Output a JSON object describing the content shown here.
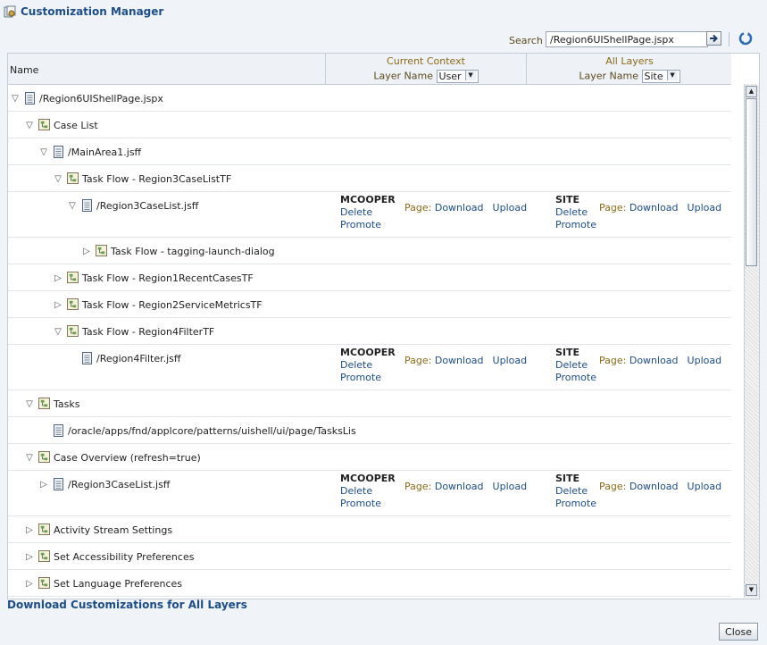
{
  "window": {
    "title": "Customization Manager"
  },
  "search": {
    "label": "Search",
    "value": "/Region6UIShellPage.jspx"
  },
  "header": {
    "name": "Name",
    "current_context": {
      "caption": "Current Context",
      "layer_label": "Layer Name",
      "layer_value": "User"
    },
    "all_layers": {
      "caption": "All Layers",
      "layer_label": "Layer Name",
      "layer_value": "Site"
    }
  },
  "common": {
    "delete": "Delete",
    "promote": "Promote",
    "page": "Page:",
    "download": "Download",
    "upload": "Upload"
  },
  "rows": [
    {
      "label": "/Region6UIShellPage.jspx",
      "depth": 0,
      "disc": "▽",
      "icon": "page-icon"
    },
    {
      "label": "Case List",
      "depth": 1,
      "disc": "▽",
      "icon": "taskflow-icon"
    },
    {
      "label": "/MainArea1.jsff",
      "depth": 2,
      "disc": "▽",
      "icon": "page-icon"
    },
    {
      "label": "Task Flow - Region3CaseListTF",
      "depth": 3,
      "disc": "▽",
      "icon": "taskflow-icon"
    },
    {
      "label": "/Region3CaseList.jsff",
      "depth": 4,
      "disc": "▽",
      "icon": "page-icon",
      "cust": {
        "user": "MCOOPER",
        "site": "SITE"
      }
    },
    {
      "label": "Task Flow - tagging-launch-dialog",
      "depth": 5,
      "disc": "▷",
      "icon": "taskflow-icon"
    },
    {
      "label": "Task Flow - Region1RecentCasesTF",
      "depth": 3,
      "disc": "▷",
      "icon": "taskflow-icon"
    },
    {
      "label": "Task Flow - Region2ServiceMetricsTF",
      "depth": 3,
      "disc": "▷",
      "icon": "taskflow-icon"
    },
    {
      "label": "Task Flow - Region4FilterTF",
      "depth": 3,
      "disc": "▽",
      "icon": "taskflow-icon"
    },
    {
      "label": "/Region4Filter.jsff",
      "depth": 4,
      "disc": "",
      "icon": "page-icon",
      "cust": {
        "user": "MCOOPER",
        "site": "SITE"
      }
    },
    {
      "label": "Tasks",
      "depth": 1,
      "disc": "▽",
      "icon": "taskflow-icon"
    },
    {
      "label": "/oracle/apps/fnd/applcore/patterns/uishell/ui/page/TasksLis",
      "depth": 2,
      "disc": "",
      "icon": "page-icon"
    },
    {
      "label": "Case Overview (refresh=true)",
      "depth": 1,
      "disc": "▽",
      "icon": "taskflow-icon"
    },
    {
      "label": "/Region3CaseList.jsff",
      "depth": 2,
      "disc": "▷",
      "icon": "page-icon",
      "cust": {
        "user": "MCOOPER",
        "site": "SITE"
      }
    },
    {
      "label": "Activity Stream Settings",
      "depth": 1,
      "disc": "▷",
      "icon": "taskflow-icon"
    },
    {
      "label": "Set Accessibility Preferences",
      "depth": 1,
      "disc": "▷",
      "icon": "taskflow-icon"
    },
    {
      "label": "Set Language Preferences",
      "depth": 1,
      "disc": "▷",
      "icon": "taskflow-icon"
    }
  ],
  "footer": {
    "download_all": "Download Customizations for All Layers",
    "close": "Close"
  },
  "colors": {
    "link": "#1d4d8a",
    "label_gold": "#8a6a1a"
  }
}
